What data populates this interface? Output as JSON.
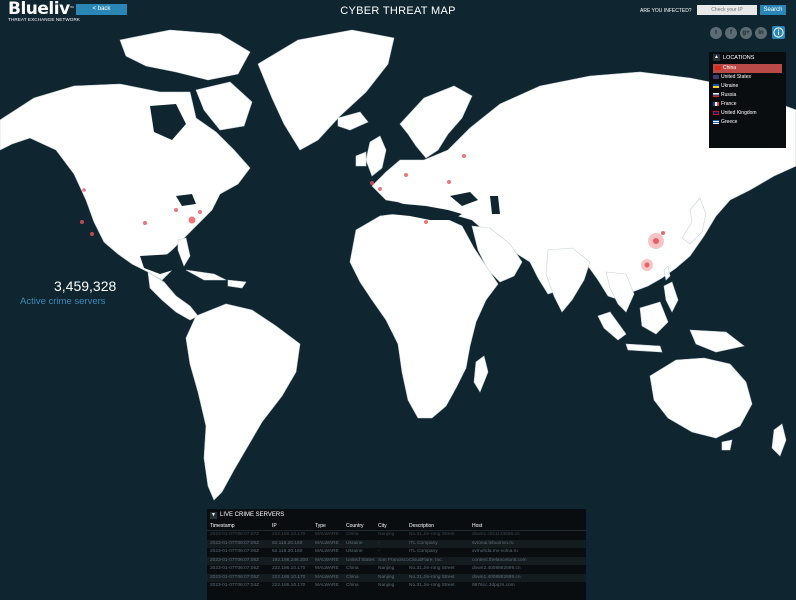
{
  "header": {
    "logo": {
      "name": "Blueliv",
      "tm": "™",
      "subtitle": "THREAT EXCHANGE NETWORK"
    },
    "back_label": "< back",
    "title": "CYBER THREAT MAP",
    "infected_label": "ARE YOU INFECTED?",
    "check_ip_placeholder": "Check your IP",
    "search_label": "Search"
  },
  "social": [
    {
      "icon": "twitter-icon",
      "glyph": "t"
    },
    {
      "icon": "facebook-icon",
      "glyph": "f"
    },
    {
      "icon": "google-plus-icon",
      "glyph": "g+"
    },
    {
      "icon": "linkedin-icon",
      "glyph": "in"
    }
  ],
  "locations": {
    "title": "LOCATIONS",
    "items": [
      {
        "label": "China",
        "selected": true,
        "flag": "#de2910"
      },
      {
        "label": "United States",
        "selected": false,
        "flag": "#3c3b6e"
      },
      {
        "label": "Ukraine",
        "selected": false,
        "flag": "#0057b7"
      },
      {
        "label": "Russia",
        "selected": false,
        "flag": "#d52b1e"
      },
      {
        "label": "France",
        "selected": false,
        "flag": "#0055a4"
      },
      {
        "label": "United Kingdom",
        "selected": false,
        "flag": "#012169"
      },
      {
        "label": "Greece",
        "selected": false,
        "flag": "#0d5eaf"
      }
    ]
  },
  "stats": {
    "count": "3,459,328",
    "label": "Active crime servers"
  },
  "live": {
    "title": "LIVE CRIME SERVERS",
    "columns": [
      "Timestamp",
      "IP",
      "Type",
      "Country",
      "City",
      "Description",
      "Host"
    ],
    "rows": [
      [
        "2023-01-07T06:07:07Z",
        "222.186.10.170",
        "MALWARE",
        "China",
        "Nanjing",
        "No.31,Jin-rong Street",
        "down1.c511133666.cn"
      ],
      [
        "2023-01-07T06:07:06Z",
        "62.118.20.169",
        "MALWARE",
        "Ukraine",
        "-",
        "ITL Company",
        "svtonai.lebuonvo.ru"
      ],
      [
        "2023-01-07T06:07:06Z",
        "62.118.20.160",
        "MALWARE",
        "Ukraine",
        "-",
        "ITL Company",
        "xvmuhda.mv-volna.ru"
      ],
      [
        "2023-01-07T06:07:05Z",
        "192.198.246.200",
        "MALWARE",
        "United States",
        "San Francisco",
        "CloudFlare, Inc.",
        "content.thelancetunit.com"
      ],
      [
        "2023-01-07T06:07:05Z",
        "222.186.10.170",
        "MALWARE",
        "China",
        "Nanjing",
        "No.31,Jin-rong Street",
        "down2.4008882699.cn"
      ],
      [
        "2023-01-07T06:07:05Z",
        "222.186.10.170",
        "MALWARE",
        "China",
        "Nanjing",
        "No.31,Jin-rong Street",
        "down1.4008882699.cn"
      ],
      [
        "2023-01-07T06:07:04Z",
        "222.186.10.170",
        "MALWARE",
        "China",
        "Nanjing",
        "No.31,Jin-rong Street",
        "9876cc.3dpqzs.com"
      ]
    ]
  },
  "colors": {
    "ocean": "#0f2631",
    "land": "#ffffff",
    "accent": "#2a87b5",
    "threat": "#e8555a",
    "selected": "#b94a48"
  }
}
